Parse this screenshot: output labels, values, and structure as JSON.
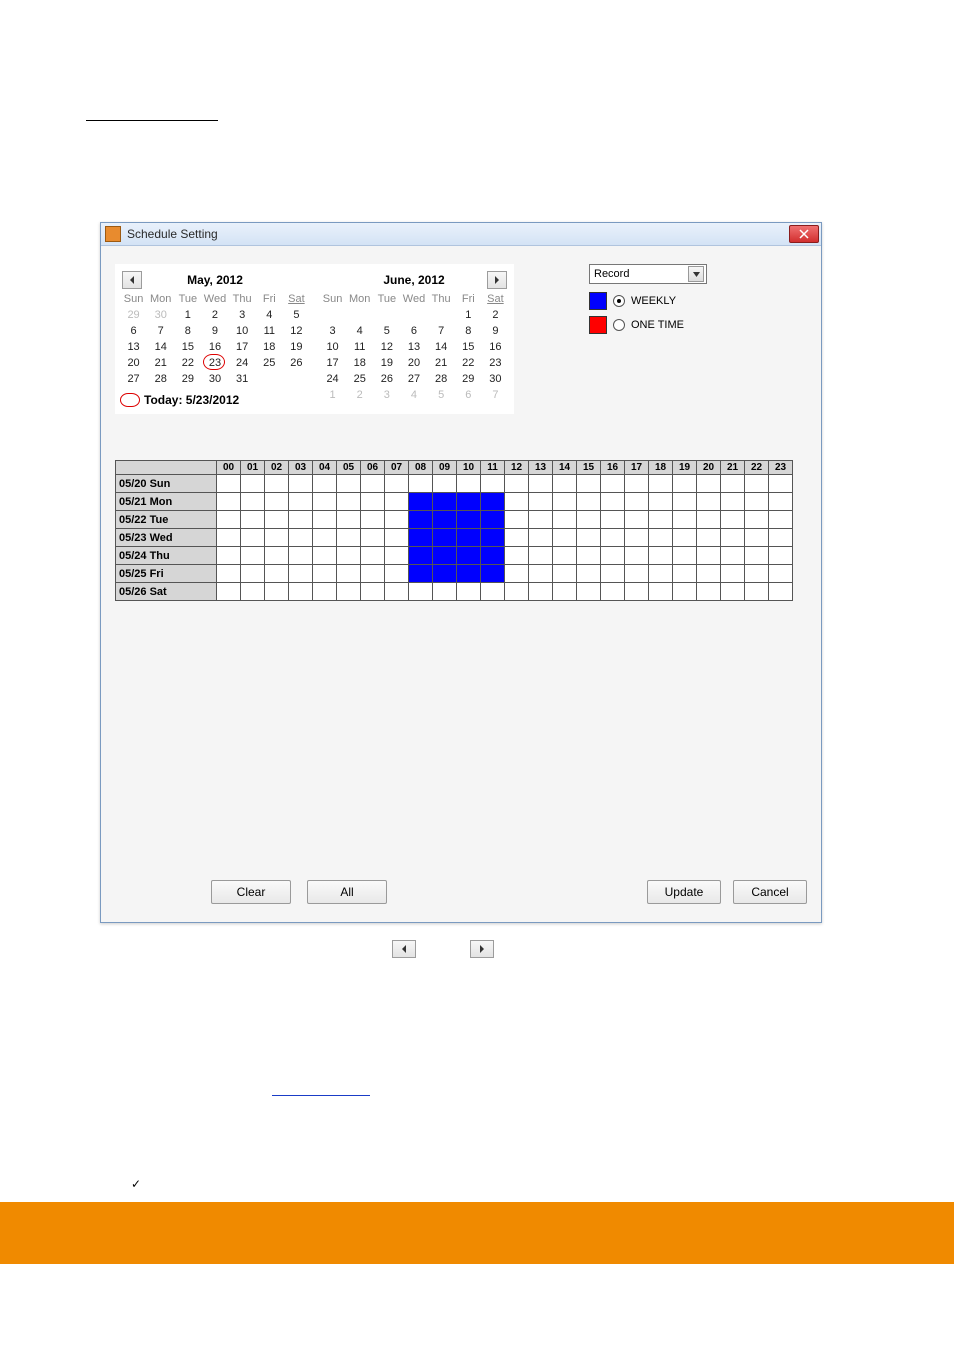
{
  "window": {
    "title": "Schedule Setting",
    "close_glyph": "×"
  },
  "calendars": {
    "prev_glyph": "◂",
    "next_glyph": "▸",
    "months": [
      {
        "title": "May, 2012",
        "dows": [
          "Sun",
          "Mon",
          "Tue",
          "Wed",
          "Thu",
          "Fri",
          "Sat"
        ],
        "weeks": [
          [
            {
              "n": "29",
              "muted": true
            },
            {
              "n": "30",
              "muted": true
            },
            {
              "n": "1"
            },
            {
              "n": "2"
            },
            {
              "n": "3"
            },
            {
              "n": "4"
            },
            {
              "n": "5"
            }
          ],
          [
            {
              "n": "6"
            },
            {
              "n": "7"
            },
            {
              "n": "8"
            },
            {
              "n": "9"
            },
            {
              "n": "10"
            },
            {
              "n": "11"
            },
            {
              "n": "12"
            }
          ],
          [
            {
              "n": "13"
            },
            {
              "n": "14"
            },
            {
              "n": "15"
            },
            {
              "n": "16"
            },
            {
              "n": "17"
            },
            {
              "n": "18"
            },
            {
              "n": "19"
            }
          ],
          [
            {
              "n": "20"
            },
            {
              "n": "21"
            },
            {
              "n": "22"
            },
            {
              "n": "23",
              "today": true
            },
            {
              "n": "24"
            },
            {
              "n": "25"
            },
            {
              "n": "26"
            }
          ],
          [
            {
              "n": "27"
            },
            {
              "n": "28"
            },
            {
              "n": "29"
            },
            {
              "n": "30"
            },
            {
              "n": "31"
            },
            {
              "n": ""
            },
            {
              "n": ""
            }
          ]
        ]
      },
      {
        "title": "June, 2012",
        "dows": [
          "Sun",
          "Mon",
          "Tue",
          "Wed",
          "Thu",
          "Fri",
          "Sat"
        ],
        "weeks": [
          [
            {
              "n": ""
            },
            {
              "n": ""
            },
            {
              "n": ""
            },
            {
              "n": ""
            },
            {
              "n": ""
            },
            {
              "n": "1"
            },
            {
              "n": "2"
            }
          ],
          [
            {
              "n": "3"
            },
            {
              "n": "4"
            },
            {
              "n": "5"
            },
            {
              "n": "6"
            },
            {
              "n": "7"
            },
            {
              "n": "8"
            },
            {
              "n": "9"
            }
          ],
          [
            {
              "n": "10"
            },
            {
              "n": "11"
            },
            {
              "n": "12"
            },
            {
              "n": "13"
            },
            {
              "n": "14"
            },
            {
              "n": "15"
            },
            {
              "n": "16"
            }
          ],
          [
            {
              "n": "17"
            },
            {
              "n": "18"
            },
            {
              "n": "19"
            },
            {
              "n": "20"
            },
            {
              "n": "21"
            },
            {
              "n": "22"
            },
            {
              "n": "23"
            }
          ],
          [
            {
              "n": "24"
            },
            {
              "n": "25"
            },
            {
              "n": "26"
            },
            {
              "n": "27"
            },
            {
              "n": "28"
            },
            {
              "n": "29"
            },
            {
              "n": "30"
            }
          ],
          [
            {
              "n": "1",
              "muted": true
            },
            {
              "n": "2",
              "muted": true
            },
            {
              "n": "3",
              "muted": true
            },
            {
              "n": "4",
              "muted": true
            },
            {
              "n": "5",
              "muted": true
            },
            {
              "n": "6",
              "muted": true
            },
            {
              "n": "7",
              "muted": true
            }
          ]
        ]
      }
    ],
    "today_label": "Today: 5/23/2012"
  },
  "side": {
    "dropdown_value": "Record",
    "weekly_label": "WEEKLY",
    "onetime_label": "ONE TIME",
    "selected": "weekly"
  },
  "schedule": {
    "hours": [
      "00",
      "01",
      "02",
      "03",
      "04",
      "05",
      "06",
      "07",
      "08",
      "09",
      "10",
      "11",
      "12",
      "13",
      "14",
      "15",
      "16",
      "17",
      "18",
      "19",
      "20",
      "21",
      "22",
      "23"
    ],
    "days": [
      {
        "label": "05/20 Sun",
        "on": []
      },
      {
        "label": "05/21 Mon",
        "on": [
          8,
          9,
          10,
          11
        ]
      },
      {
        "label": "05/22 Tue",
        "on": [
          8,
          9,
          10,
          11
        ]
      },
      {
        "label": "05/23 Wed",
        "on": [
          8,
          9,
          10,
          11
        ]
      },
      {
        "label": "05/24 Thu",
        "on": [
          8,
          9,
          10,
          11
        ]
      },
      {
        "label": "05/25 Fri",
        "on": [
          8,
          9,
          10,
          11
        ]
      },
      {
        "label": "05/26 Sat",
        "on": []
      }
    ]
  },
  "buttons": {
    "clear": "Clear",
    "all": "All",
    "update": "Update",
    "cancel": "Cancel"
  },
  "checkmark": "✓"
}
